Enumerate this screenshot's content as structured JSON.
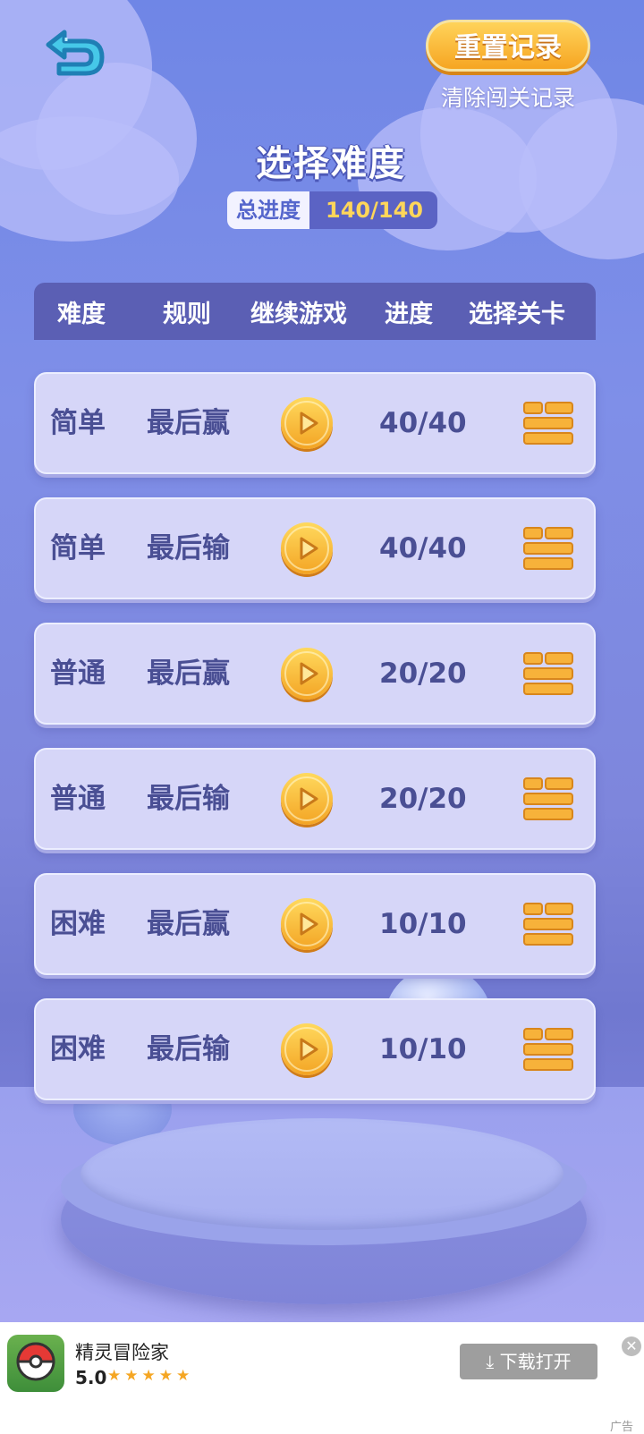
{
  "header": {
    "back_icon": "back-arrow-icon",
    "reset_button": "重置记录",
    "reset_subtitle": "清除闯关记录",
    "title": "选择难度",
    "total_label": "总进度",
    "total_value": "140/140"
  },
  "table": {
    "columns": [
      "难度",
      "规则",
      "继续游戏",
      "进度",
      "选择关卡"
    ],
    "rows": [
      {
        "difficulty": "简单",
        "rule": "最后赢",
        "progress": "40/40"
      },
      {
        "difficulty": "简单",
        "rule": "最后输",
        "progress": "40/40"
      },
      {
        "difficulty": "普通",
        "rule": "最后赢",
        "progress": "20/20"
      },
      {
        "difficulty": "普通",
        "rule": "最后输",
        "progress": "20/20"
      },
      {
        "difficulty": "困难",
        "rule": "最后赢",
        "progress": "10/10"
      },
      {
        "difficulty": "困难",
        "rule": "最后输",
        "progress": "10/10"
      }
    ],
    "play_icon": "play-icon",
    "level_select_icon": "level-list-icon"
  },
  "ad": {
    "app_name": "精灵冒险家",
    "rating": "5.0",
    "stars": "★★★★★",
    "button": "下载打开",
    "close": "✕",
    "tag": "广告"
  },
  "colors": {
    "accent_orange": "#f6a522",
    "text_blue": "#4a4f94",
    "header_bar": "#5b5fb4"
  }
}
